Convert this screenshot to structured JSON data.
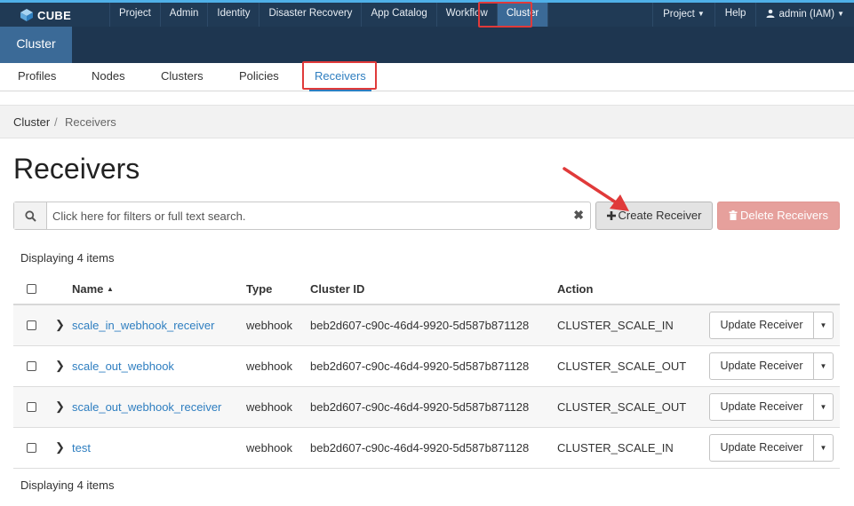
{
  "brand": {
    "name": "CUBE",
    "logo_icon": "cube-logo-icon"
  },
  "topnav": {
    "items": [
      "Project",
      "Admin",
      "Identity",
      "Disaster Recovery",
      "App Catalog",
      "Workflow",
      "Cluster"
    ],
    "active": "Cluster",
    "right": {
      "project": "Project",
      "help": "Help",
      "user": "admin (IAM)"
    }
  },
  "subbar": {
    "tab": "Cluster"
  },
  "navtabs": {
    "items": [
      "Profiles",
      "Nodes",
      "Clusters",
      "Policies",
      "Receivers"
    ],
    "active": "Receivers"
  },
  "breadcrumb": {
    "root": "Cluster",
    "separator": "/",
    "current": "Receivers"
  },
  "page": {
    "title": "Receivers"
  },
  "search": {
    "placeholder": "Click here for filters or full text search.",
    "value": "",
    "clear_symbol": "✖"
  },
  "actions": {
    "create": "Create Receiver",
    "create_icon": "plus-icon",
    "delete": "Delete Receivers",
    "delete_icon": "trash-icon"
  },
  "summary": {
    "top": "Displaying 4 items",
    "bottom": "Displaying 4 items"
  },
  "table": {
    "headers": {
      "name": "Name",
      "type": "Type",
      "cluster_id": "Cluster ID",
      "action": "Action"
    },
    "sort": {
      "column": "Name",
      "direction": "ascending",
      "symbol": "▲"
    },
    "rows": [
      {
        "name": "scale_in_webhook_receiver",
        "type": "webhook",
        "cluster_id": "beb2d607-c90c-46d4-9920-5d587b871128",
        "action": "CLUSTER_SCALE_IN",
        "button": "Update Receiver"
      },
      {
        "name": "scale_out_webhook",
        "type": "webhook",
        "cluster_id": "beb2d607-c90c-46d4-9920-5d587b871128",
        "action": "CLUSTER_SCALE_OUT",
        "button": "Update Receiver"
      },
      {
        "name": "scale_out_webhook_receiver",
        "type": "webhook",
        "cluster_id": "beb2d607-c90c-46d4-9920-5d587b871128",
        "action": "CLUSTER_SCALE_OUT",
        "button": "Update Receiver"
      },
      {
        "name": "test",
        "type": "webhook",
        "cluster_id": "beb2d607-c90c-46d4-9920-5d587b871128",
        "action": "CLUSTER_SCALE_IN",
        "button": "Update Receiver"
      }
    ]
  },
  "colors": {
    "navbar": "#203a55",
    "accent": "#3b6a97",
    "link": "#2e7ec0",
    "highlight": "#e03a3a",
    "delete_button": "#e6a09c"
  }
}
